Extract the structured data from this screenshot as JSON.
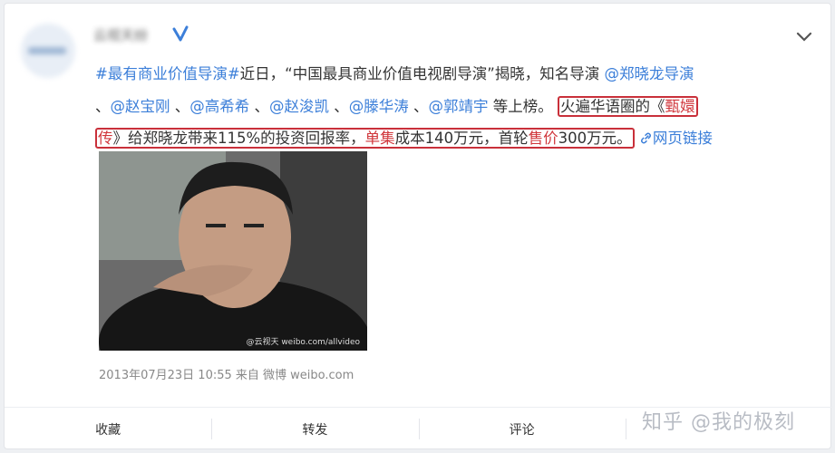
{
  "post": {
    "author_name": "云视天纷",
    "hashtag": "#最有商业价值导演#",
    "intro1": "近日，“中国最具商业价值电视剧导演”揭晓，知名导演 ",
    "mentions": [
      "@郑晓龙导演",
      "@赵宝刚",
      "@高希希",
      "@赵浚凯",
      "@滕华涛",
      "@郭靖宇"
    ],
    "list_sep1": "、",
    "list_end": " 等上榜。",
    "hl1_prefix": "火遍华语圈的《",
    "hl1_red": "甄嬛",
    "hl2_red": "传",
    "hl2_a": "》给郑晓龙带来115%的投资回报率，",
    "hl2_red2": "单集",
    "hl2_b": "成本140万元，首轮",
    "hl2_red3": "售价",
    "hl2_c": "300万元。",
    "web_link": "网页链接",
    "photo_watermark": "@云视天 weibo.com/allvideo",
    "timestamp": "2013年07月23日 10:55",
    "source": "来自 微博 weibo.com"
  },
  "actions": {
    "favorite": "收藏",
    "repost": "转发",
    "comment": "评论"
  },
  "watermark": "知乎 @我的极刻",
  "colors": {
    "link_blue": "#3c7fd9",
    "hashtag_orange": "#eb7350",
    "highlight_red": "#c9303a"
  }
}
